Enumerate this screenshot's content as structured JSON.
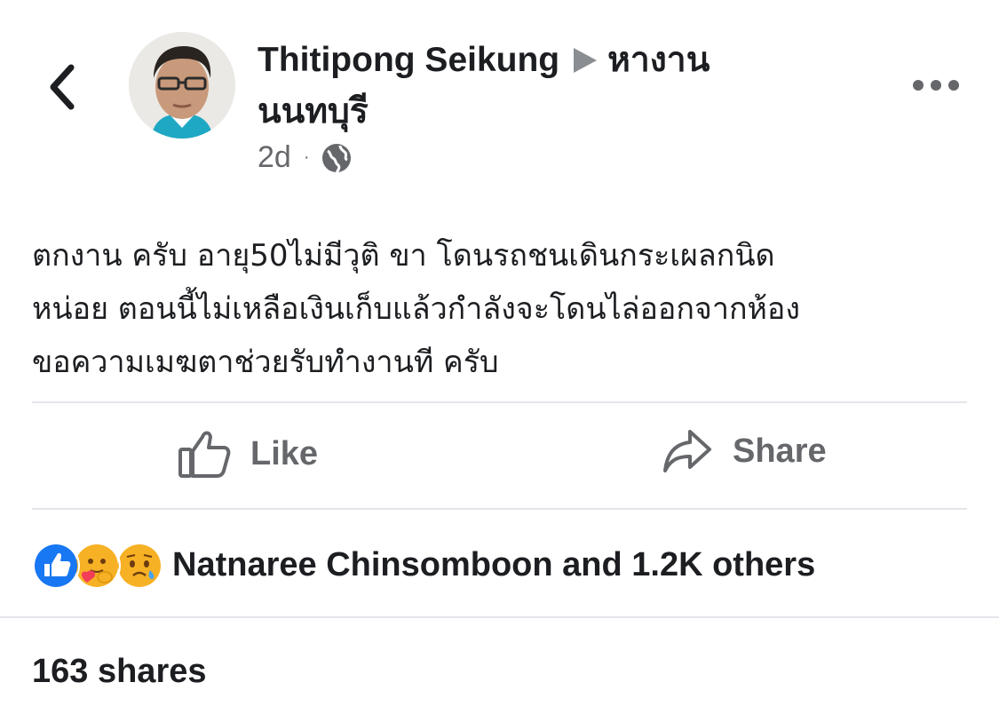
{
  "header": {
    "author": "Thitipong Seikung",
    "group_line1": "หางาน",
    "group_line2": "นนทบุรี",
    "time": "2d",
    "dot": "·",
    "privacy_icon": "globe-icon",
    "back_icon": "chevron-left-icon",
    "more_icon": "more-horizontal-icon"
  },
  "post": {
    "lines": [
      "ตกงาน ครับ อายุ50ไม่มีวุติ ขา โดนรถชนเดินกระเผลกนิด",
      "หน่อย ตอนนี้ไม่เหลือเงินเก็บแล้วกำลังจะโดนไล่ออกจากห้อง",
      "ขอความเมฆตาช่วยรับทำงานที ครับ"
    ]
  },
  "actions": {
    "like_label": "Like",
    "share_label": "Share"
  },
  "reactions": {
    "icons": [
      "like-reaction-icon",
      "care-reaction-icon",
      "sad-reaction-icon"
    ],
    "summary": "Natnaree Chinsomboon and 1.2K others"
  },
  "shares": {
    "label": "163 shares"
  },
  "colors": {
    "text": "#1c1e21",
    "secondary": "#65676b",
    "like_blue": "#1877f2",
    "divider": "#e4e6eb"
  }
}
